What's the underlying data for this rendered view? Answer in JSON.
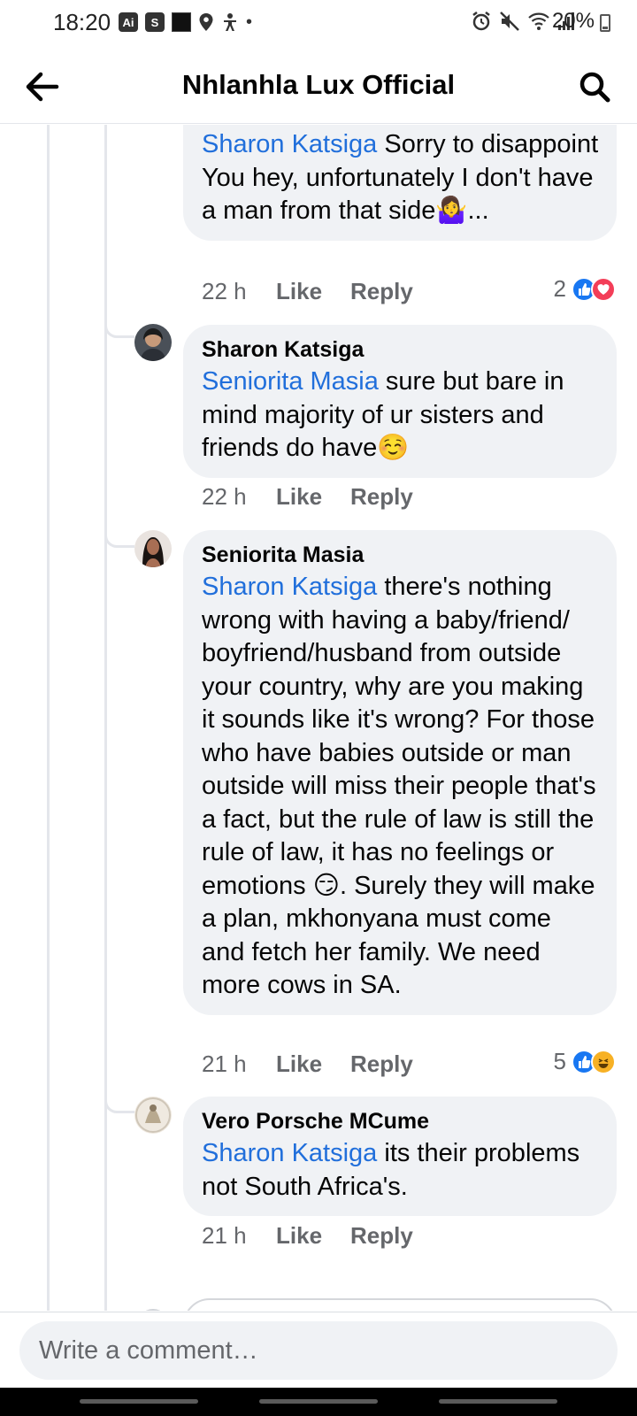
{
  "status_bar": {
    "time": "18:20",
    "left_icons": [
      "Ai",
      "S"
    ],
    "battery": "20%"
  },
  "header": {
    "title": "Nhlanhla Lux Official"
  },
  "comments": [
    {
      "author": "",
      "mention": "Sharon Katsiga",
      "text": " Sorry to disappoint You hey, unfortunately I don't have a man from that side🤷‍♀️...",
      "time": "22 h",
      "like": "Like",
      "reply": "Reply",
      "reaction_count": "2",
      "reactions": [
        "like-icon",
        "love-icon"
      ]
    },
    {
      "author": "Sharon Katsiga",
      "mention": "Seniorita Masia",
      "text": " sure but bare in mind majority of ur sisters and friends do have☺️",
      "time": "22 h",
      "like": "Like",
      "reply": "Reply",
      "reaction_count": "",
      "reactions": []
    },
    {
      "author": "Seniorita Masia",
      "mention": "Sharon Katsiga",
      "text": " there's nothing wrong with having a baby/friend/ boyfriend/husband  from outside your country, why are you making it sounds like it's wrong? For those who have babies outside or man outside will miss their people that's a fact, but the rule of law is still the rule of law, it has no feelings or emotions 😏. Surely they will make a plan, mkhonyana must come and fetch her family. We need more cows in SA.",
      "time": "21 h",
      "like": "Like",
      "reply": "Reply",
      "reaction_count": "5",
      "reactions": [
        "like-icon",
        "haha-icon"
      ]
    },
    {
      "author": "Vero Porsche MCume",
      "mention": "Sharon Katsiga",
      "text": " its their problems not South Africa's.",
      "time": "21 h",
      "like": "Like",
      "reply": "Reply",
      "reaction_count": "",
      "reactions": []
    }
  ],
  "composer": {
    "placeholder": "Write a comment…"
  },
  "colors": {
    "mention": "#216fdb",
    "bubble": "#f0f2f5",
    "like_blue": "#1877f2",
    "love_red": "#f33e58",
    "haha_yellow": "#f7b125"
  }
}
